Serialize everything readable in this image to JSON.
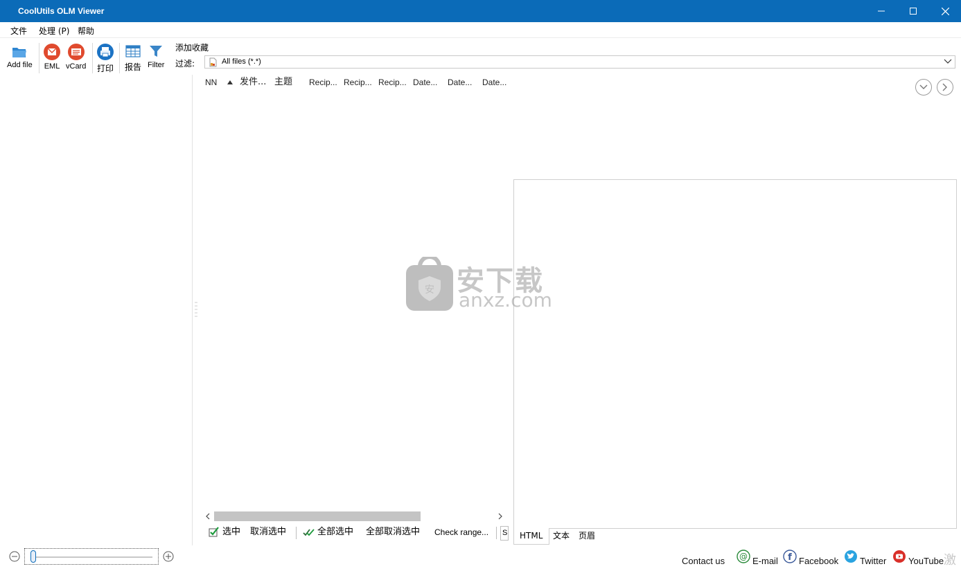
{
  "window": {
    "title": "CoolUtils OLM Viewer",
    "title_bar_color": "#0b6bb8"
  },
  "menu": {
    "items": [
      {
        "label": "文件"
      },
      {
        "label": "处理 (P)"
      },
      {
        "label": "帮助"
      }
    ]
  },
  "toolbar": {
    "add_file": "Add file",
    "eml": "EML",
    "vcard": "vCard",
    "print": "打印",
    "report": "报告",
    "filter": "Filter",
    "favorites_label": "添加收藏",
    "filter_label": "过滤:",
    "filter_value": "All files (*.*)"
  },
  "message_list": {
    "columns": [
      "NN",
      "发件...",
      "主题",
      "Recip...",
      "Recip...",
      "Recip...",
      "Date...",
      "Date...",
      "Date..."
    ]
  },
  "selection_bar": {
    "select": "选中",
    "deselect": "取消选中",
    "select_all": "全部选中",
    "deselect_all": "全部取消选中",
    "check_range": "Check range...",
    "search_stub": "S"
  },
  "preview_tabs": [
    "HTML",
    "文本",
    "页眉"
  ],
  "status_bar": {
    "contact": "Contact us",
    "email": "E-mail",
    "facebook": "Facebook",
    "twitter": "Twitter",
    "youtube": "YouTube"
  },
  "watermark": {
    "cn": "安下载",
    "en": "anxz.com"
  },
  "corner_text": "激",
  "icons": [
    "folder-open-icon",
    "eml-envelope-icon",
    "vcard-icon",
    "printer-icon",
    "report-table-icon",
    "filter-funnel-icon",
    "document-icon",
    "dropdown-arrow-icon",
    "chevron-down-circle-icon",
    "chevron-right-circle-icon",
    "checkbox-checked-icon",
    "double-check-icon",
    "zoom-out-icon",
    "zoom-in-icon",
    "email-at-icon",
    "facebook-icon",
    "twitter-icon",
    "youtube-icon"
  ],
  "colors": {
    "accent": "#0b6bb8",
    "eml_red": "#e04a2e",
    "scroll_thumb": "#c4c4c4"
  }
}
